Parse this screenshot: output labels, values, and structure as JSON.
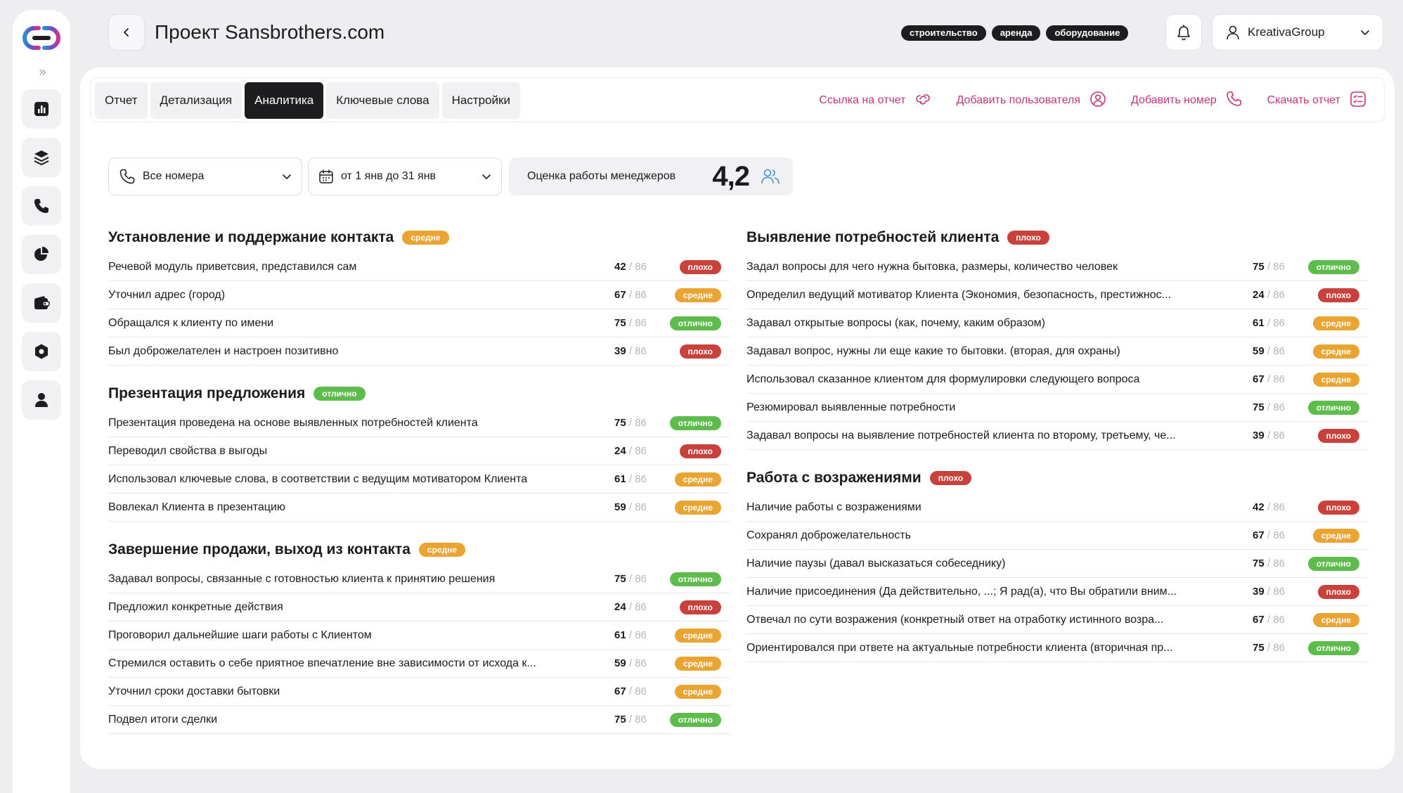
{
  "colors": {
    "accent": "#c2357f",
    "good": "#5ebc4c",
    "avg": "#e9a432",
    "bad": "#c8413b",
    "dark": "#1d1d20"
  },
  "sidebar": {
    "expand_label": "»",
    "items": [
      {
        "name": "reports-icon"
      },
      {
        "name": "layers-icon"
      },
      {
        "name": "phone-icon"
      },
      {
        "name": "pie-chart-icon"
      },
      {
        "name": "wallet-icon"
      },
      {
        "name": "settings-icon"
      },
      {
        "name": "user-icon"
      }
    ]
  },
  "header": {
    "title": "Проект Sansbrothers.com",
    "tags": [
      "строительство",
      "аренда",
      "оборудование"
    ],
    "account_name": "KreativaGroup"
  },
  "tabs": [
    {
      "label": "Отчет",
      "active": false
    },
    {
      "label": "Детализация",
      "active": false
    },
    {
      "label": "Аналитика",
      "active": true
    },
    {
      "label": "Ключевые слова",
      "active": false
    },
    {
      "label": "Настройки",
      "active": false
    }
  ],
  "actions": [
    {
      "label": "Ссылка на отчет",
      "icon": "link-icon"
    },
    {
      "label": "Добавить пользователя",
      "icon": "user-circle-icon"
    },
    {
      "label": "Добавить номер",
      "icon": "phone-icon"
    },
    {
      "label": "Скачать отчет",
      "icon": "checklist-icon"
    }
  ],
  "filters": {
    "numbers": "Все номера",
    "period": "от 1 янв до 31 янв"
  },
  "rating": {
    "label": "Оценка работы менеджеров",
    "value": "4,2"
  },
  "status_labels": {
    "good": "отлично",
    "avg": "средне",
    "bad": "плохо"
  },
  "total": "86",
  "columns": [
    [
      {
        "title": "Установление и поддержание контакта",
        "status": "avg",
        "rows": [
          {
            "label": "Речевой модуль приветсвия, представился сам",
            "score": "42",
            "status": "bad"
          },
          {
            "label": "Уточнил адрес (город)",
            "score": "67",
            "status": "avg"
          },
          {
            "label": "Обращался к клиенту по имени",
            "score": "75",
            "status": "good"
          },
          {
            "label": "Был доброжелателен и настроен позитивно",
            "score": "39",
            "status": "bad"
          }
        ]
      },
      {
        "title": "Презентация предложения",
        "status": "good",
        "rows": [
          {
            "label": "Презентация проведена на основе выявленных потребностей клиента",
            "score": "75",
            "status": "good"
          },
          {
            "label": "Переводил свойства в выгоды",
            "score": "24",
            "status": "bad"
          },
          {
            "label": "Использовал ключевые слова, в соответствии с ведущим мотиватором Клиента",
            "score": "61",
            "status": "avg"
          },
          {
            "label": "Вовлекал Клиента в презентацию",
            "score": "59",
            "status": "avg"
          }
        ]
      },
      {
        "title": "Завершение продажи, выход из контакта",
        "status": "avg",
        "rows": [
          {
            "label": "Задавал вопросы, связанные с готовностью клиента к принятию решения",
            "score": "75",
            "status": "good"
          },
          {
            "label": "Предложил конкретные действия",
            "score": "24",
            "status": "bad"
          },
          {
            "label": "Проговорил дальнейшие шаги работы с Клиентом",
            "score": "61",
            "status": "avg"
          },
          {
            "label": "Стремился оставить о себе приятное впечатление вне зависимости от исхода к...",
            "score": "59",
            "status": "avg"
          },
          {
            "label": "Уточнил сроки доставки бытовки",
            "score": "67",
            "status": "avg"
          },
          {
            "label": "Подвел итоги сделки",
            "score": "75",
            "status": "good"
          }
        ]
      }
    ],
    [
      {
        "title": "Выявление потребностей клиента",
        "status": "bad",
        "rows": [
          {
            "label": "Задал вопросы для чего нужна бытовка, размеры, количество человек",
            "score": "75",
            "status": "good"
          },
          {
            "label": "Определил ведущий мотиватор Клиента (Экономия, безопасность, престижнос...",
            "score": "24",
            "status": "bad"
          },
          {
            "label": "Задавал открытые вопросы (как, почему, каким образом)",
            "score": "61",
            "status": "avg"
          },
          {
            "label": "Задавал вопрос, нужны ли еще какие то бытовки. (вторая, для охраны)",
            "score": "59",
            "status": "avg"
          },
          {
            "label": "Использовал сказанное клиентом для формулировки следующего вопроса",
            "score": "67",
            "status": "avg"
          },
          {
            "label": "Резюмировал выявленные потребности",
            "score": "75",
            "status": "good"
          },
          {
            "label": "Задавал вопросы на выявление потребностей клиента по второму, третьему, че...",
            "score": "39",
            "status": "bad"
          }
        ]
      },
      {
        "title": "Работа с возражениями",
        "status": "bad",
        "rows": [
          {
            "label": "Наличие работы с возражениями",
            "score": "42",
            "status": "bad"
          },
          {
            "label": "Сохранял доброжелательность",
            "score": "67",
            "status": "avg"
          },
          {
            "label": "Наличие паузы (давал высказаться собеседнику)",
            "score": "75",
            "status": "good"
          },
          {
            "label": "Наличие присоединения (Да действительно, ...; Я рад(а), что Вы обратили вним...",
            "score": "39",
            "status": "bad"
          },
          {
            "label": "Отвечал по сути возражения (конкретный ответ на отработку истинного возра...",
            "score": "67",
            "status": "avg"
          },
          {
            "label": "Ориентировался при ответе на актуальные потребности клиента (вторичная пр...",
            "score": "75",
            "status": "good"
          }
        ]
      }
    ]
  ]
}
